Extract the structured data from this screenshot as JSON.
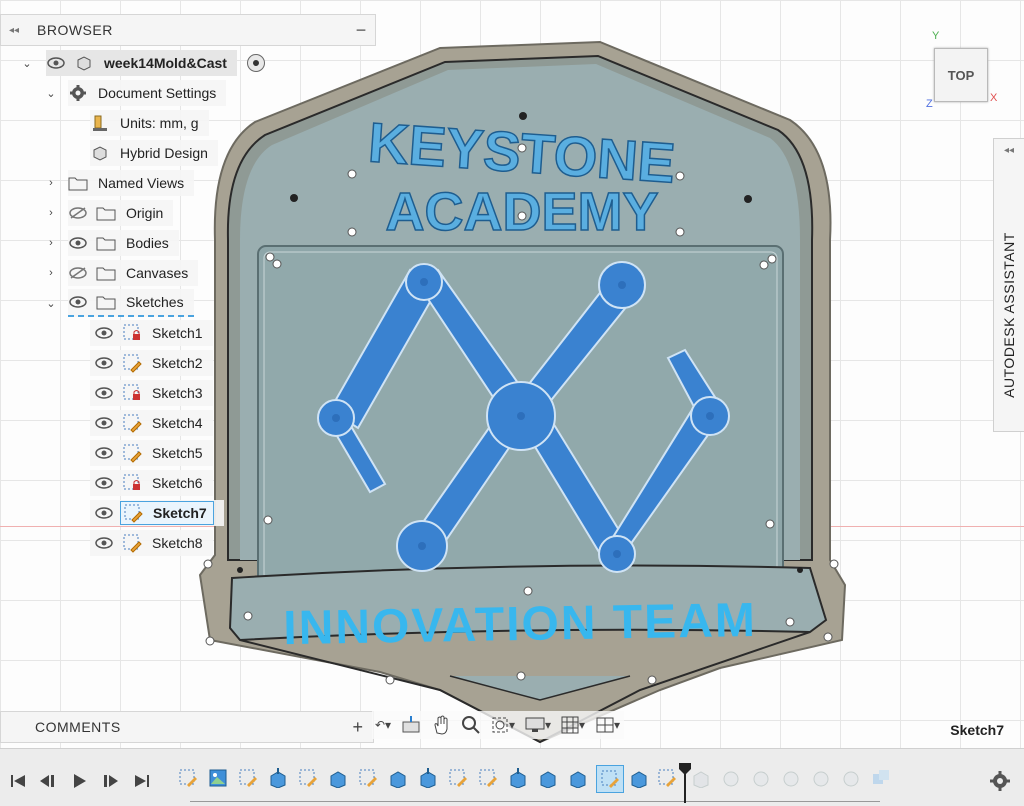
{
  "browser": {
    "title": "BROWSER",
    "root": "week14Mold&Cast",
    "document_settings": "Document Settings",
    "units": "Units: mm, g",
    "design_type": "Hybrid Design",
    "folders": [
      {
        "label": "Named Views"
      },
      {
        "label": "Origin"
      },
      {
        "label": "Bodies"
      },
      {
        "label": "Canvases"
      },
      {
        "label": "Sketches"
      }
    ],
    "sketches": [
      {
        "label": "Sketch1",
        "locked": true
      },
      {
        "label": "Sketch2",
        "locked": false
      },
      {
        "label": "Sketch3",
        "locked": true
      },
      {
        "label": "Sketch4",
        "locked": false
      },
      {
        "label": "Sketch5",
        "locked": false
      },
      {
        "label": "Sketch6",
        "locked": true
      },
      {
        "label": "Sketch7",
        "locked": false,
        "selected": true
      },
      {
        "label": "Sketch8",
        "locked": false
      }
    ]
  },
  "comments": {
    "title": "COMMENTS"
  },
  "viewcube": {
    "face": "TOP",
    "axis_x": "X",
    "axis_y": "Y",
    "axis_z": "Z"
  },
  "assistant": {
    "label": "AUTODESK ASSISTANT"
  },
  "status": {
    "active_sketch": "Sketch7"
  },
  "model": {
    "top_text_line1": "KEYSTONE",
    "top_text_line2": "ACADEMY",
    "bottom_text": "INNOVATION TEAM"
  },
  "colors": {
    "accent": "#4aa3df",
    "model_frame": "#a7a293",
    "model_fill": "#9aaeb0",
    "logo_blue": "#3a82d0",
    "text_blue": "#5aaee0",
    "lock_red": "#cc3333"
  }
}
